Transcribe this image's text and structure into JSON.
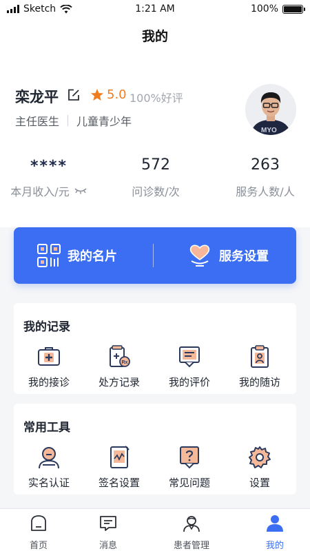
{
  "status_bar": {
    "carrier": "Sketch",
    "time": "1:21 AM",
    "battery": "100%"
  },
  "nav": {
    "title": "我的"
  },
  "profile": {
    "name": "栾龙平",
    "rating": "5.0",
    "praise": "100%好评",
    "position": "主任医生",
    "department": "儿童青少年"
  },
  "stats": [
    {
      "value": "****",
      "label": "本月收入/元"
    },
    {
      "value": "572",
      "label": "问诊数/次"
    },
    {
      "value": "263",
      "label": "服务人数/人"
    }
  ],
  "blue_card": {
    "card_label": "我的名片",
    "service_label": "服务设置"
  },
  "records": {
    "title": "我的记录",
    "items": [
      {
        "label": "我的接诊",
        "icon": "medical-kit-icon"
      },
      {
        "label": "处方记录",
        "icon": "prescription-icon"
      },
      {
        "label": "我的评价",
        "icon": "review-icon"
      },
      {
        "label": "我的随访",
        "icon": "follow-up-icon"
      }
    ]
  },
  "tools": {
    "title": "常用工具",
    "items": [
      {
        "label": "实名认证",
        "icon": "verify-icon"
      },
      {
        "label": "签名设置",
        "icon": "signature-icon"
      },
      {
        "label": "常见问题",
        "icon": "faq-icon"
      },
      {
        "label": "设置",
        "icon": "gear-icon"
      }
    ]
  },
  "tabbar": {
    "items": [
      {
        "label": "首页",
        "icon": "home-icon"
      },
      {
        "label": "消息",
        "icon": "message-icon"
      },
      {
        "label": "患者管理",
        "icon": "patient-icon"
      },
      {
        "label": "我的",
        "icon": "profile-icon"
      }
    ],
    "active": "我的"
  },
  "colors": {
    "accent": "#3b6ef3",
    "star": "#f07c1f",
    "icon_dark": "#2b3a5c",
    "icon_fill": "#f5b99a"
  }
}
